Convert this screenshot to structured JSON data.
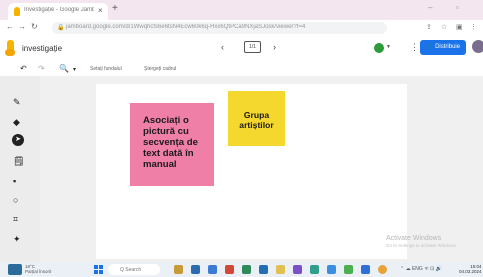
{
  "browser": {
    "tab_title": "Investigație - Google Jamboard",
    "tab_close": "×",
    "new_tab": "+",
    "win_min": "–",
    "win_max": "▫",
    "url": "jamboard.google.com/d/1Wwqhcfs6e6tsN4Ecw60k6q-Hxx6QtPCa9NXjaSJosk/viewer?f=4"
  },
  "app": {
    "name": "investigație",
    "page_indicator": "1/1",
    "distribute_label": "Distribuie"
  },
  "toolbar": {
    "set_background": "Setați fundalul",
    "clear_frame": "Ștergeți cadrul"
  },
  "notes": {
    "pink": "Asociați o pictură cu secvența de text dată în manual",
    "yellow": "Grupa artiștilor"
  },
  "watermark": {
    "line1": "Activate Windows",
    "line2": "Go to Settings to activate Windows."
  },
  "taskbar": {
    "weather_temp": "18°C",
    "weather_desc": "Parțial însorit",
    "search_label": "Q Search",
    "tray": "⌃ ☁ ENG ᯤ ⊡ 🔊",
    "time": "15:04",
    "date": "04.03.2024"
  },
  "colors": {
    "pink_note": "#f07fa8",
    "yellow_note": "#f5d82e",
    "accent": "#1a73e8"
  }
}
